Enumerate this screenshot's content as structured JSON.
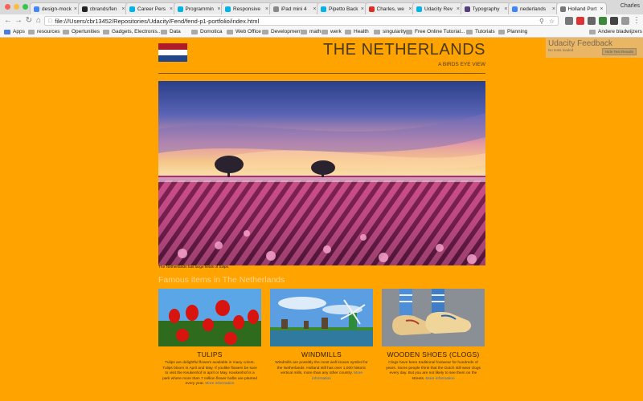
{
  "browser": {
    "tabs": [
      {
        "label": "design-mock",
        "favicon": "google-icon",
        "color": "#4285f4"
      },
      {
        "label": "cbrands/fen",
        "favicon": "github-icon",
        "color": "#222222"
      },
      {
        "label": "Career Pers",
        "favicon": "udacity-icon",
        "color": "#02b3e4"
      },
      {
        "label": "Programmin",
        "favicon": "udacity-icon",
        "color": "#02b3e4"
      },
      {
        "label": "Responsive",
        "favicon": "udacity-icon",
        "color": "#02b3e4"
      },
      {
        "label": "iPad mini 4",
        "favicon": "apple-icon",
        "color": "#888888"
      },
      {
        "label": "Pipetto Back",
        "favicon": "udacity-icon",
        "color": "#02b3e4"
      },
      {
        "label": "Charles, we",
        "favicon": "gmail-icon",
        "color": "#d93025"
      },
      {
        "label": "Udacity Rev",
        "favicon": "udacity-icon",
        "color": "#02b3e4"
      },
      {
        "label": "Typography",
        "favicon": "bootstrap-icon",
        "color": "#563d7c"
      },
      {
        "label": "nederlands",
        "favicon": "google-icon",
        "color": "#4285f4"
      },
      {
        "label": "Holland Port",
        "favicon": "page-icon",
        "color": "#777777",
        "active": true
      }
    ],
    "profile_name": "Charles",
    "address": "file:///Users/cbr13452/Repositories/Udacity/Fend/fend-p1-portfolio/index.html",
    "bookmarks": [
      "Apps",
      "resources",
      "Opertunities",
      "Gadgets, Electronis...",
      "Data",
      "Domotica",
      "Web Office",
      "Development",
      "math",
      "werk",
      "Health",
      "singularity",
      "Free Online Tutorial...",
      "Tutorials",
      "Planning",
      "Andere bladwijzers"
    ]
  },
  "header": {
    "title": "THE NETHERLANDS",
    "subtitle": "A BIRDS EYE VIEW",
    "flag_colors": [
      "#ae1c28",
      "#ffffff",
      "#21468b"
    ]
  },
  "feedback_widget": {
    "title": "Udacity Feedback",
    "body": "No tests loaded",
    "button": "Hide Test Results"
  },
  "hero": {
    "caption": "The Netherlands has large fields of tulips."
  },
  "section": {
    "title": "Famous items in The Netherlands"
  },
  "cards": [
    {
      "title": "TULIPS",
      "description": "Tulips are delightful flowers available in many colors. Tulips bloom in April and May. If youlike flowers be sure to visit the Keukenhof in april or May. Keukenhof is a park where more than 7 million flower bulbs are planted every year.",
      "more": "More information"
    },
    {
      "title": "WINDMILLS",
      "description": "Windmills are possibly the most well known symbol for the Netherlands. Holland still has over 1,000 historic vertical mills, more than any other country.",
      "more": "More information"
    },
    {
      "title": "WOODEN SHOES (CLOGS)",
      "description": "Clogs have been traditional footwear for hundreds of years. Some people think that the Dutch still wear clogs every day. But you are not likely to see them on the streets.",
      "more": "More information"
    }
  ]
}
